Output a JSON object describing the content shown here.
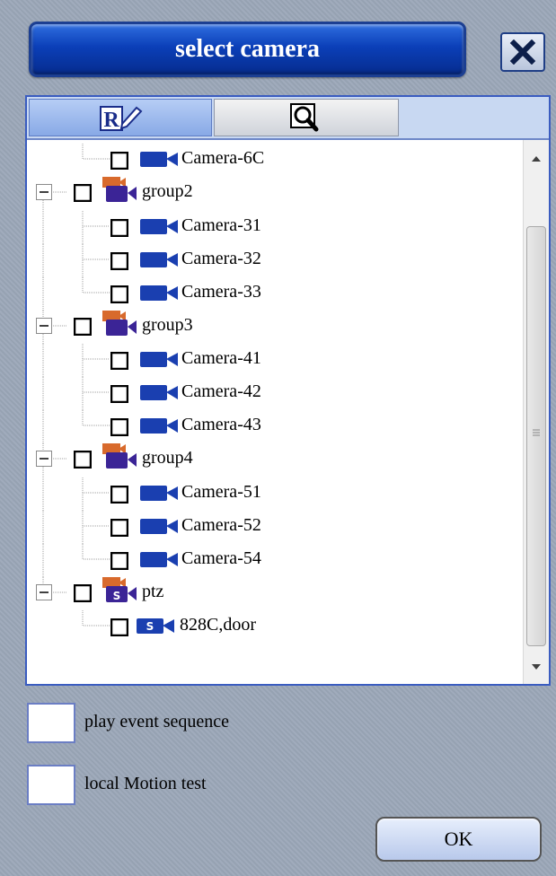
{
  "dialog": {
    "title": "select camera",
    "close_icon": "close-x-icon"
  },
  "tabs": [
    {
      "name": "record",
      "icon": "record-edit-icon",
      "active": true
    },
    {
      "name": "search",
      "icon": "magnifier-icon",
      "active": false
    }
  ],
  "tree": {
    "rows": [
      {
        "type": "camera",
        "label": "Camera-6C",
        "checked": false
      },
      {
        "type": "group",
        "label": "group2",
        "expanded": true,
        "checked": false
      },
      {
        "type": "camera",
        "label": "Camera-31",
        "checked": false
      },
      {
        "type": "camera",
        "label": "Camera-32",
        "checked": false
      },
      {
        "type": "camera",
        "label": "Camera-33",
        "checked": false
      },
      {
        "type": "group",
        "label": "group3",
        "expanded": true,
        "checked": false
      },
      {
        "type": "camera",
        "label": "Camera-41",
        "checked": false
      },
      {
        "type": "camera",
        "label": "Camera-42",
        "checked": false
      },
      {
        "type": "camera",
        "label": "Camera-43",
        "checked": false
      },
      {
        "type": "group",
        "label": "group4",
        "expanded": true,
        "checked": false
      },
      {
        "type": "camera",
        "label": "Camera-51",
        "checked": false
      },
      {
        "type": "camera",
        "label": "Camera-52",
        "checked": false
      },
      {
        "type": "camera",
        "label": "Camera-54",
        "checked": false
      },
      {
        "type": "ptz-group",
        "label": "ptz",
        "expanded": true,
        "checked": false
      },
      {
        "type": "ptz-camera",
        "label": "828C,door",
        "checked": false
      }
    ]
  },
  "options": {
    "play_event_sequence": "play event sequence",
    "local_motion_test": "local Motion test"
  },
  "footer": {
    "ok_label": "OK"
  },
  "colors": {
    "title_blue": "#0b3fb8",
    "camera_blue": "#1a3fb0",
    "group_orange": "#d86a2c",
    "group_purple": "#3b2496"
  }
}
